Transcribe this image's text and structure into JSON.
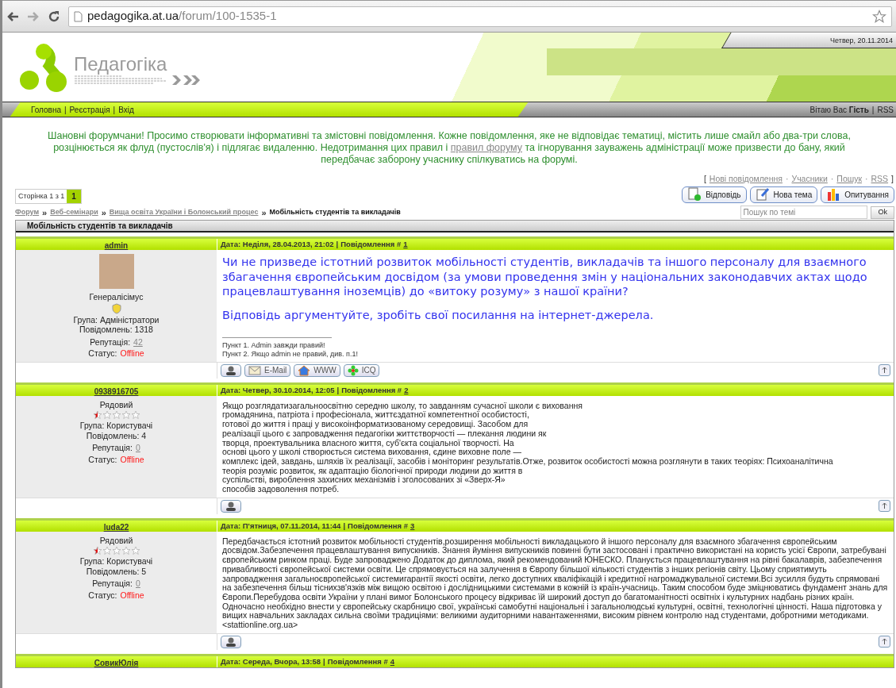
{
  "browser": {
    "url_host": "pedagogika.at.ua",
    "url_path": "/forum/100-1535-1"
  },
  "header": {
    "date": "Четвер, 20.11.2014",
    "site_name": "Педагогіка"
  },
  "nav": {
    "links": [
      "Головна",
      "Реєстрація",
      "Вхід"
    ],
    "separator": "|",
    "greeting": "Вітаю Вас",
    "user": "Гість",
    "rss": "RSS"
  },
  "notice": {
    "before": "Шановні форумчани! Просимо створювати інформативні та змістовні повідомлення. Кожне повідомлення, яке не відповідає тематиці, містить лише смайл або два-три слова, розцінюється як флуд (пустослів'я) і підлягає видаленню. Недотримання цих правил і ",
    "link": "правил форуму",
    "after": " та ігнорування зауважень адміністрації може призвести до бану, який передбачає заборону учаснику спілкуватись на форумі."
  },
  "top_links": {
    "open": "[",
    "close": "]",
    "separator": "·",
    "links": [
      "Нові повідомлення",
      "Учасники",
      "Пошук",
      "RSS"
    ]
  },
  "pager": {
    "label": "Сторінка 1 з 1",
    "pages": [
      {
        "label": "1",
        "selected": true
      }
    ]
  },
  "actions": [
    {
      "kind": "reply",
      "label": "Відповідь"
    },
    {
      "kind": "new",
      "label": "Нова тема"
    },
    {
      "kind": "poll",
      "label": "Опитування"
    }
  ],
  "breadcrumb": {
    "links": [
      "Форум",
      "Веб-семінари",
      "Вища освіта України і Болонський процес"
    ],
    "separator": "»",
    "current": "Мобільність студентів та викладачів"
  },
  "search": {
    "placeholder": "Пошук по темі",
    "button": "Ok"
  },
  "topic_title": "Мобільність студентів та викладачів",
  "posts": [
    {
      "kind": "large",
      "author": {
        "name": "admin",
        "kind": "admin",
        "rank": "Генералісімус",
        "group": "Група: Адміністратори",
        "posts": "Повідомлень: 1318",
        "reputation_label": "Репутація:",
        "reputation": "42",
        "status_label": "Статус:",
        "status": "Offline"
      },
      "date": "Дата: Неділя, 28.04.2013, 21:02",
      "separator": "|",
      "number_label": "Повідомлення #",
      "number": "1",
      "lines": [
        "Чи не призведе істотний розвиток мобільності студентів, викладачів та іншого персоналу для взаємного збагачення європейським досвідом (за умови проведення змін у національних законодавчих актах щодо працевлаштування іноземців) до «витоку розуму» з нашої країни?",
        "Відповідь аргументуйте, зробіть свої посилання на інтернет-джерела."
      ],
      "signature": [
        "Пункт 1. Admin завжди правий!",
        "Пункт 2. Якщо admin не правий, див. п.1!"
      ],
      "buttons": [
        {
          "kind": "profile"
        },
        {
          "kind": "email",
          "label": "E-Mail"
        },
        {
          "kind": "www",
          "label": "WWW"
        },
        {
          "kind": "icq",
          "label": "ICQ"
        }
      ]
    },
    {
      "kind": "normal",
      "author": {
        "name": "0938916705",
        "kind": "user",
        "stars": 0.5,
        "rank": "Рядовий",
        "group": "Група: Користувачі",
        "posts": "Повідомлень: 4",
        "reputation_label": "Репутація:",
        "reputation": "0",
        "status_label": "Статус:",
        "status": "Offline"
      },
      "date": "Дата: Четвер, 30.10.2014, 12:05",
      "separator": "|",
      "number_label": "Повідомлення #",
      "number": "2",
      "lines": [
        "Якщо розглядатизагальноосвітню середню школу, то завданням сучасної школи є виховання",
        "громадянина, патріота і професіонала, життєздатної компетентної особистості,",
        "готової до життя і праці у високоінформатизованому середовищі. Засобом для",
        "реалізації цього є запровадження педагогіки життєтворчості — плекання людини як",
        "творця, проектувальника власного життя, суб'єкта соціальної творчості. На",
        "основі цього у школі створюється система виховання, єдине виховне поле —",
        "комплекс ідей, завдань, шляхів їх реалізації, засобів і моніторинг результатів.Отже, розвиток особистості можна розглянути в таких теоріях: Психоаналітична",
        "теорія розуміє розвиток, як адаптацію біологічної природи людини до життя в",
        "суспільстві, вироблення захисних механізмів і зголосованих зі «Зверх-Я»",
        "способів задоволення потреб."
      ],
      "buttons": [
        {
          "kind": "profile"
        }
      ]
    },
    {
      "kind": "normal",
      "author": {
        "name": "luda22",
        "kind": "user",
        "stars": 0.5,
        "rank": "Рядовий",
        "group": "Група: Користувачі",
        "posts": "Повідомлень: 5",
        "reputation_label": "Репутація:",
        "reputation": "0",
        "status_label": "Статус:",
        "status": "Offline"
      },
      "date": "Дата: П'ятниця, 07.11.2014, 11:44",
      "separator": "|",
      "number_label": "Повідомлення #",
      "number": "3",
      "lines": [
        "Передбачається істотний розвиток мобільності студентів,розширення мобільності викладацького й іншого персоналу для взаємного збагачення європейським досвідом.Забезпечення працевлаштування випускників. Знання йуміння випускників повинні бути застосовані і практично використані на користь усієї Європи, затребувані європейським ринком праці. Буде запроваджено Додаток до диплома, який рекомендований ЮНЕСКО. Планується працевлаштування на рівні бакалаврів, забезпечення привабливості європейської системи освіти. Це спрямовується на залучення в Європу більшої кількості студентів з інших регіонів світу. Цьому сприятимуть запровадження загальноєвропейської системигарантії якості освіти, легко доступних кваліфікацій і кредитної нагромаджувальної системи.Всі зусилля будуть спрямовані на забезпечення більш тіснихзв'язків між вищою освітою і дослідницькими системами в кожній із країн-учасниць. Таким способом буде зміцнюватись фундамент знань для Європи.Перебудова освіти України у плані вимог Болонського процесу відкриває їй широкий доступ до багатоманітності освітніх і культурних надбань різних країн. Одночасно необхідно внести у європейську скарбницю свої, українські самобутні національні і загальнолюдські культурні, освітні, технологічні цінності. Наша підготовка у вищих навчальних закладах сильна своїми традиціями: великими аудиторними навантаженнями, високим рівнем контролю над студентами, добротними методиками. <stattionline.org.ua>"
      ],
      "buttons": [
        {
          "kind": "profile"
        }
      ]
    },
    {
      "kind": "cut",
      "author": {
        "name": "СовикЮлія"
      },
      "date": "Дата: Середа, Вчора, 13:58",
      "separator": "|",
      "number_label": "Повідомлення #",
      "number": "4"
    }
  ]
}
